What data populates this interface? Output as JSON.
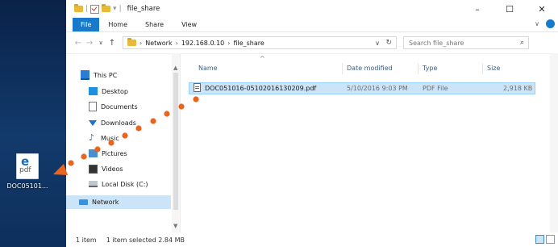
{
  "desktop": {
    "icon_label": "DOC05101..."
  },
  "window": {
    "title": "file_share",
    "controls": {
      "minimize": "–",
      "maximize": "☐",
      "close": "✕"
    }
  },
  "ribbon": {
    "file_tab": "File",
    "tabs": [
      "Home",
      "Share",
      "View"
    ],
    "expand": "∨"
  },
  "address_bar": {
    "path": [
      "Network",
      "192.168.0.10",
      "file_share"
    ],
    "search_placeholder": "Search file_share"
  },
  "nav_pane": {
    "items": [
      {
        "label": "This PC",
        "icon": "pc-icon"
      },
      {
        "label": "Desktop",
        "icon": "desktop-icon"
      },
      {
        "label": "Documents",
        "icon": "documents-icon"
      },
      {
        "label": "Downloads",
        "icon": "downloads-icon"
      },
      {
        "label": "Music",
        "icon": "music-icon"
      },
      {
        "label": "Pictures",
        "icon": "pictures-icon"
      },
      {
        "label": "Videos",
        "icon": "videos-icon"
      },
      {
        "label": "Local Disk (C:)",
        "icon": "disk-icon"
      },
      {
        "label": "Network",
        "icon": "network-icon",
        "selected": true
      }
    ]
  },
  "file_list": {
    "columns": [
      "Name",
      "Date modified",
      "Type",
      "Size"
    ],
    "rows": [
      {
        "name": "DOC051016-05102016130209.pdf",
        "date": "5/10/2016 9:03 PM",
        "type": "PDF File",
        "size": "2,918 KB"
      }
    ]
  },
  "status_bar": {
    "item_count": "1 item",
    "selection": "1 item selected  2.84 MB"
  },
  "colors": {
    "accent": "#1979ca",
    "selection": "#cce4f7",
    "drag_path": "#e8651f"
  }
}
